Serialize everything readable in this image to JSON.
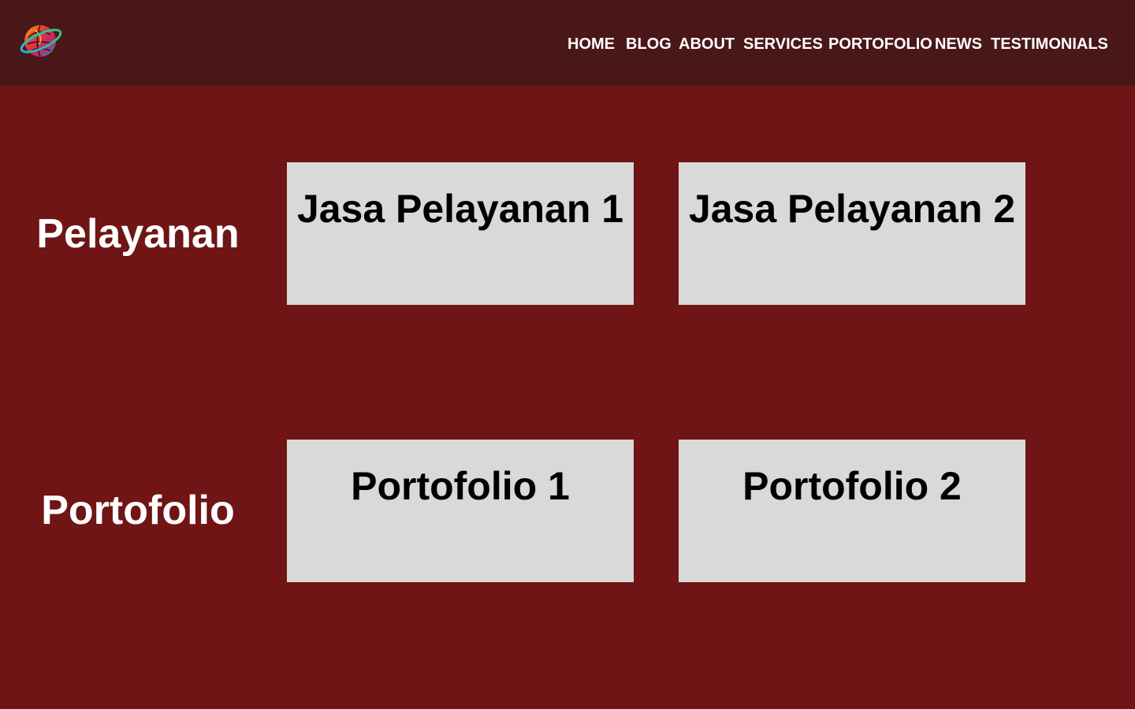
{
  "header": {
    "logo_icon": "globe-brain-logo-icon",
    "nav": [
      {
        "label": "HOME"
      },
      {
        "label": "BLOG"
      },
      {
        "label": "ABOUT"
      },
      {
        "label": "SERVICES"
      },
      {
        "label": "PORTOFOLIO"
      },
      {
        "label": "NEWS"
      },
      {
        "label": "TESTIMONIALS"
      }
    ]
  },
  "sections": {
    "services": {
      "title": "Pelayanan",
      "cards": [
        {
          "title": "Jasa Pelayanan 1"
        },
        {
          "title": "Jasa Pelayanan 2"
        }
      ]
    },
    "portfolio": {
      "title": "Portofolio",
      "cards": [
        {
          "title": "Portofolio 1"
        },
        {
          "title": "Portofolio 2"
        }
      ]
    }
  },
  "colors": {
    "header_bg": "#4a1718",
    "page_bg": "#6f1515",
    "card_bg": "#d9d9d9",
    "nav_text": "#ffffff"
  }
}
